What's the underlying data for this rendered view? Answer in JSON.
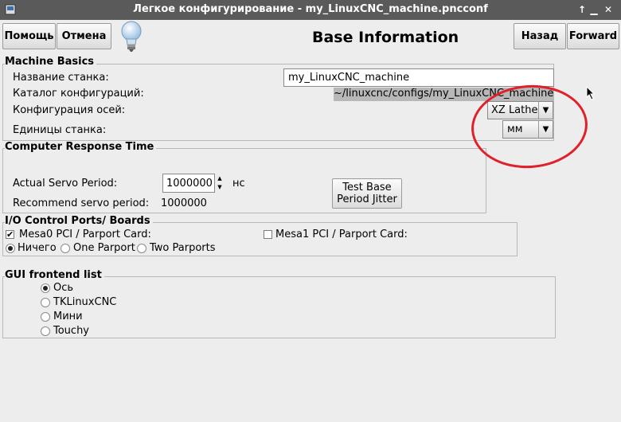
{
  "window": {
    "title": "Легкое конфигурирование - my_LinuxCNC_machine.pncconf",
    "max_icon": "up-arrow-icon",
    "close_icon": "close-icon"
  },
  "toolbar": {
    "help_label": "Помощь",
    "cancel_label": "Отмена",
    "page_title": "Base Information",
    "back_label": "Назад",
    "forward_label": "Forward"
  },
  "machine_basics": {
    "legend": "Machine Basics",
    "name_label": "Название станка:",
    "name_value": "my_LinuxCNC_machine",
    "dir_label": "Каталог конфигураций:",
    "dir_value": "~/linuxcnc/configs/my_LinuxCNC_machine",
    "axis_label": "Конфигурация осей:",
    "axis_value": "XZ Lathe",
    "units_label": "Единицы станка:",
    "units_value": "мм"
  },
  "response_time": {
    "legend": "Computer Response Time",
    "servo_label": "Actual Servo Period:",
    "servo_value": "1000000",
    "servo_unit": "нс",
    "recommend_label": "Recommend servo period:",
    "recommend_value": "1000000",
    "test_button_line1": "Test Base",
    "test_button_line2": "Period Jitter"
  },
  "io_ports": {
    "legend": "I/O Control Ports/ Boards",
    "mesa0_label": "Mesa0 PCI / Parport Card:",
    "mesa0_checked": true,
    "mesa1_label": "Mesa1 PCI / Parport Card:",
    "mesa1_checked": false,
    "parport_options": [
      "Ничего",
      "One Parport",
      "Two Parports"
    ],
    "parport_selected": 0
  },
  "gui_frontend": {
    "legend": "GUI frontend list",
    "options": [
      "Ось",
      "TKLinuxCNC",
      "Мини",
      "Touchy"
    ],
    "selected": 0
  },
  "annotation": {
    "color": "#e0202a"
  }
}
